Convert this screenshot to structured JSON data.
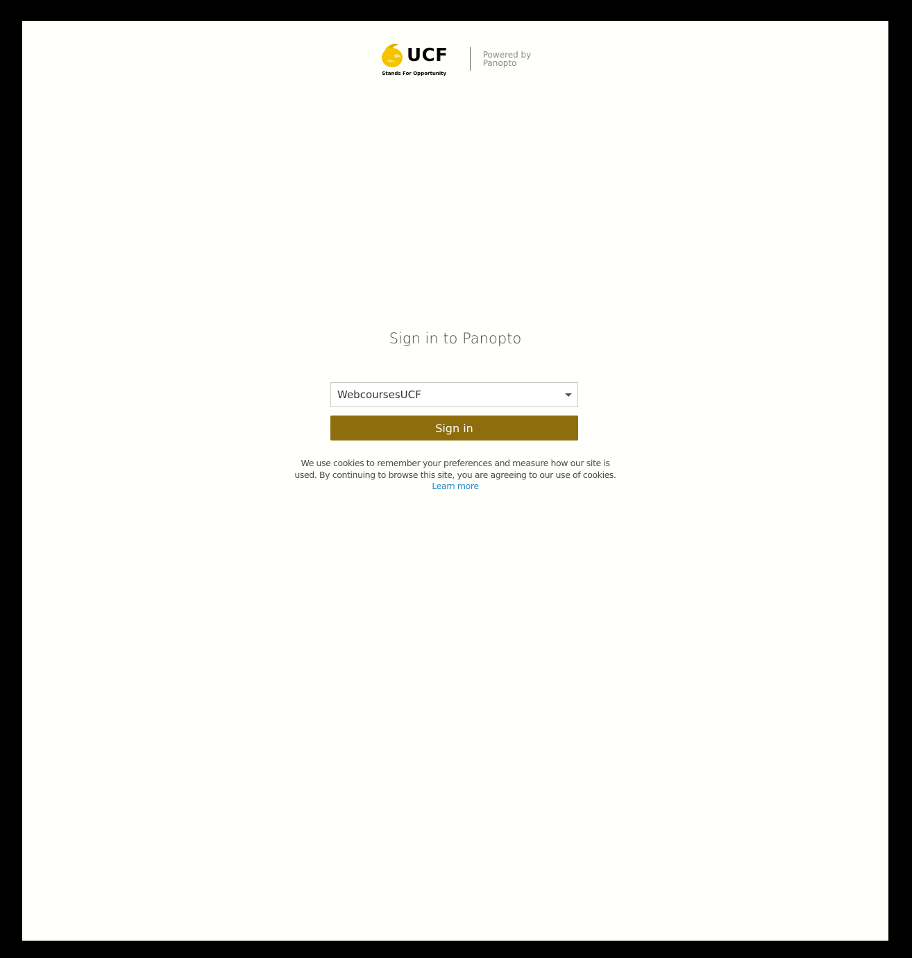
{
  "logo": {
    "brand": "UCF",
    "tagline": "Stands For Opportunity",
    "powered_by_line1": "Powered by",
    "powered_by_line2": "Panopto",
    "icon": "pegasus-icon"
  },
  "main": {
    "title": "Sign in to Panopto",
    "provider_select": {
      "value": "WebcoursesUCF"
    },
    "signin_label": "Sign in",
    "cookie_notice_line1": "We use cookies to remember your preferences and measure how our site is",
    "cookie_notice_line2": "used. By continuing to browse this site, you are agreeing to our use of cookies.",
    "learn_more": "Learn more"
  },
  "colors": {
    "accent": "#8e6d0c",
    "logo_gold": "#f5c400",
    "link": "#2d8bc9",
    "page_bg": "#fffffc",
    "frame": "#000000"
  }
}
